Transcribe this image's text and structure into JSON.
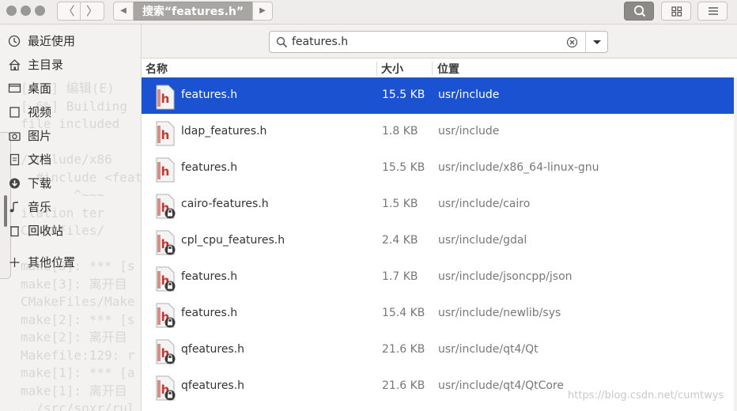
{
  "window": {
    "breadcrumb_active": "搜索“features.h”"
  },
  "nav": {
    "back_glyph": "〈",
    "forward_glyph": "〉",
    "crumb_left_glyph": "◀",
    "crumb_right_glyph": "▶"
  },
  "sidebar": {
    "items": [
      {
        "label": "最近使用",
        "icon": "clock-icon"
      },
      {
        "label": "主目录",
        "icon": "home-icon"
      },
      {
        "label": "桌面",
        "icon": "desktop-icon"
      },
      {
        "label": "视频",
        "icon": "video-icon"
      },
      {
        "label": "图片",
        "icon": "camera-icon"
      },
      {
        "label": "文档",
        "icon": "document-icon"
      },
      {
        "label": "下载",
        "icon": "download-icon"
      },
      {
        "label": "音乐",
        "icon": "music-icon"
      },
      {
        "label": "回收站",
        "icon": "trash-icon"
      },
      {
        "label": "其他位置",
        "icon": "plus-icon"
      }
    ],
    "background_terminal_text": "[  %] 编辑(E)\n[ 6%] Building\nfile included\n\n/include/x86\n  #include <feat\n       ^~~~\nilation ter\nCMakeFiles/\n\nmake[3]: *** [s\nmake[3]: 离开目\nCMakeFiles/Make\nmake[2]: *** [s\nmake[2]: 离开目\nMakefile:129: r\nmake[1]: *** [a\nmake[1]: 离开目\n../src/soxr/rul\nmake: *** [.sox"
  },
  "search": {
    "value": "features.h",
    "placeholder": ""
  },
  "columns": {
    "name": "名称",
    "size": "大小",
    "location": "位置"
  },
  "files": [
    {
      "name": "features.h",
      "size": "15.5 KB",
      "location": "usr/include",
      "locked": false,
      "selected": true
    },
    {
      "name": "ldap_features.h",
      "size": "1.8 KB",
      "location": "usr/include",
      "locked": false,
      "selected": false
    },
    {
      "name": "features.h",
      "size": "15.5 KB",
      "location": "usr/include/x86_64-linux-gnu",
      "locked": false,
      "selected": false
    },
    {
      "name": "cairo-features.h",
      "size": "1.5 KB",
      "location": "usr/include/cairo",
      "locked": true,
      "selected": false
    },
    {
      "name": "cpl_cpu_features.h",
      "size": "2.4 KB",
      "location": "usr/include/gdal",
      "locked": true,
      "selected": false
    },
    {
      "name": "features.h",
      "size": "1.7 KB",
      "location": "usr/include/jsoncpp/json",
      "locked": true,
      "selected": false
    },
    {
      "name": "features.h",
      "size": "15.4 KB",
      "location": "usr/include/newlib/sys",
      "locked": true,
      "selected": false
    },
    {
      "name": "qfeatures.h",
      "size": "21.6 KB",
      "location": "usr/include/qt4/Qt",
      "locked": true,
      "selected": false
    },
    {
      "name": "qfeatures.h",
      "size": "21.6 KB",
      "location": "usr/include/qt4/QtCore",
      "locked": true,
      "selected": false
    }
  ],
  "watermark": "https://blog.csdn.net/cumtwys",
  "colors": {
    "selection": "#1a52d2",
    "header_bg": "#efedeb",
    "sidebar_bg": "#f3f2f1",
    "file_icon_red": "#c0392b"
  }
}
